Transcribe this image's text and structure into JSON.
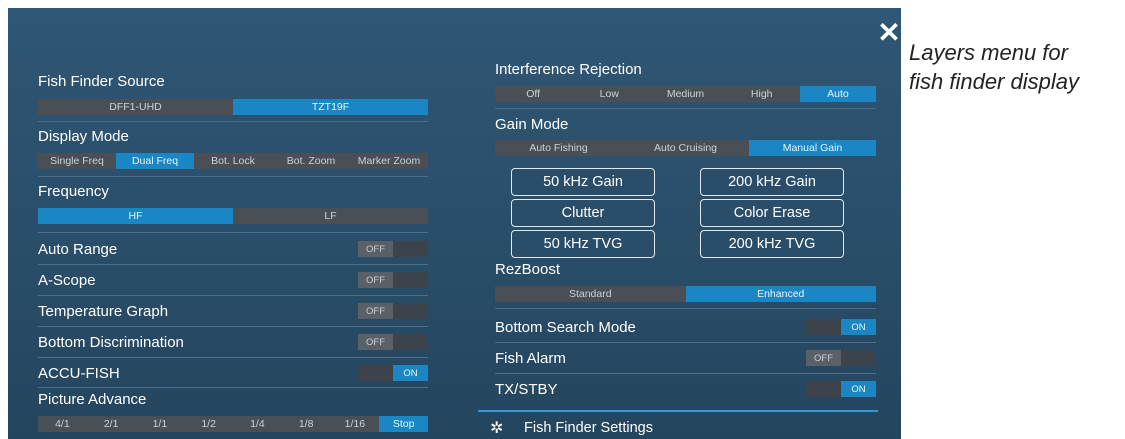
{
  "caption": {
    "line1": "Layers menu for",
    "line2": "fish finder display"
  },
  "close_glyph": "✕",
  "left": {
    "fish_finder_source": {
      "label": "Fish Finder Source",
      "options": [
        "DFF1-UHD",
        "TZT19F"
      ],
      "selected": "TZT19F"
    },
    "display_mode": {
      "label": "Display Mode",
      "options": [
        "Single Freq",
        "Dual Freq",
        "Bot. Lock",
        "Bot. Zoom",
        "Marker Zoom"
      ],
      "selected": "Dual Freq"
    },
    "frequency": {
      "label": "Frequency",
      "options": [
        "HF",
        "LF"
      ],
      "selected": "HF"
    },
    "auto_range": {
      "label": "Auto Range",
      "state": "OFF"
    },
    "a_scope": {
      "label": "A-Scope",
      "state": "OFF"
    },
    "temperature_graph": {
      "label": "Temperature Graph",
      "state": "OFF"
    },
    "bottom_discrimination": {
      "label": "Bottom Discrimination",
      "state": "OFF"
    },
    "accu_fish": {
      "label": "ACCU-FISH",
      "state": "ON"
    },
    "picture_advance": {
      "label": "Picture Advance",
      "options": [
        "4/1",
        "2/1",
        "1/1",
        "1/2",
        "1/4",
        "1/8",
        "1/16",
        "Stop"
      ],
      "selected": "Stop"
    }
  },
  "right": {
    "interference_rejection": {
      "label": "Interference Rejection",
      "options": [
        "Off",
        "Low",
        "Medium",
        "High",
        "Auto"
      ],
      "selected": "Auto"
    },
    "gain_mode": {
      "label": "Gain Mode",
      "options": [
        "Auto Fishing",
        "Auto Cruising",
        "Manual Gain"
      ],
      "selected": "Manual Gain"
    },
    "gain_buttons": [
      "50 kHz Gain",
      "200 kHz Gain",
      "Clutter",
      "Color Erase",
      "50 kHz TVG",
      "200 kHz TVG"
    ],
    "rezboost": {
      "label": "RezBoost",
      "options": [
        "Standard",
        "Enhanced"
      ],
      "selected": "Enhanced"
    },
    "bottom_search_mode": {
      "label": "Bottom Search Mode",
      "state": "ON"
    },
    "fish_alarm": {
      "label": "Fish Alarm",
      "state": "OFF"
    },
    "tx_stby": {
      "label": "TX/STBY",
      "state": "ON"
    }
  },
  "footer": {
    "settings_label": "Fish Finder Settings",
    "icon": "gear-icon"
  },
  "colors": {
    "accent": "#1b86c4",
    "panel": "#2b4f6b",
    "segment": "#4a4f55"
  }
}
